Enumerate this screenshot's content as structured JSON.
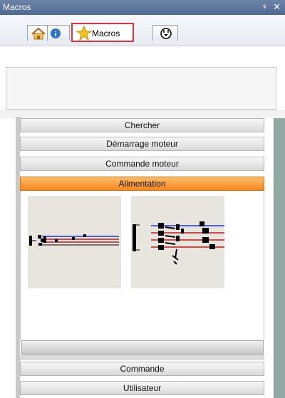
{
  "window": {
    "title": "Macros",
    "pin_icon": "pin-icon",
    "close_icon": "close-icon"
  },
  "tabs": [
    {
      "id": "home",
      "icon": "home-icon"
    },
    {
      "id": "info",
      "icon": "info-icon"
    },
    {
      "id": "macros",
      "label": "Macros",
      "icon": "star-icon",
      "selected": true,
      "highlight_color": "#e2313b"
    },
    {
      "id": "plug",
      "icon": "plug-icon"
    }
  ],
  "accordion": {
    "items": [
      {
        "label": "Chercher"
      },
      {
        "label": "Démarrage moteur"
      },
      {
        "label": "Commande moteur"
      },
      {
        "label": "Alimentation",
        "active": true,
        "color": "#f5861f"
      },
      {
        "label": "Commande"
      },
      {
        "label": "Utilisateur"
      }
    ]
  },
  "macro_thumbnails": [
    {
      "name": "alimentation-macro-1"
    },
    {
      "name": "alimentation-macro-2"
    }
  ]
}
